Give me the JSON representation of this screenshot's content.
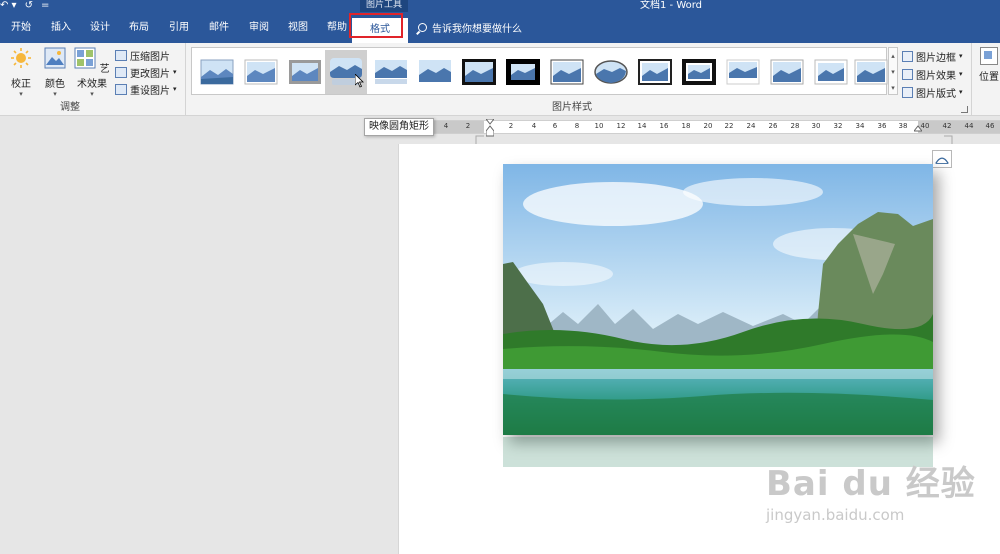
{
  "titlebar": {
    "qat_undo": "↶ ▾",
    "qat_redo": "↺",
    "qat_custom": "=",
    "context_group": "图片工具",
    "doc_title": "文档1 - Word"
  },
  "tabs": [
    {
      "label": "开始"
    },
    {
      "label": "插入"
    },
    {
      "label": "设计"
    },
    {
      "label": "布局"
    },
    {
      "label": "引用"
    },
    {
      "label": "邮件"
    },
    {
      "label": "审阅"
    },
    {
      "label": "视图"
    },
    {
      "label": "帮助"
    },
    {
      "label": "格式"
    }
  ],
  "tellme": "告诉我你想要做什么",
  "adjust": {
    "corrections": "校正",
    "color": "颜色",
    "artistic": "艺术效果",
    "compress": "压缩图片",
    "change": "更改图片",
    "reset": "重设图片",
    "group_label": "调整"
  },
  "styles": {
    "group_label": "图片样式",
    "border": "图片边框",
    "effects": "图片效果",
    "layout": "图片版式",
    "position": "位置"
  },
  "tooltip": "映像圆角矩形",
  "ruler": {
    "ticks": [
      "4",
      "2",
      "2",
      "4",
      "6",
      "8",
      "10",
      "12",
      "14",
      "16",
      "18",
      "20",
      "22",
      "24",
      "26",
      "28",
      "30",
      "32",
      "34",
      "36",
      "38",
      "40",
      "42",
      "44",
      "46"
    ]
  },
  "watermark": {
    "line1": "Bai du 经验",
    "line2": "jingyan.baidu.com"
  },
  "colors": {
    "brand": "#2b579a",
    "highlight": "#e0242a"
  }
}
